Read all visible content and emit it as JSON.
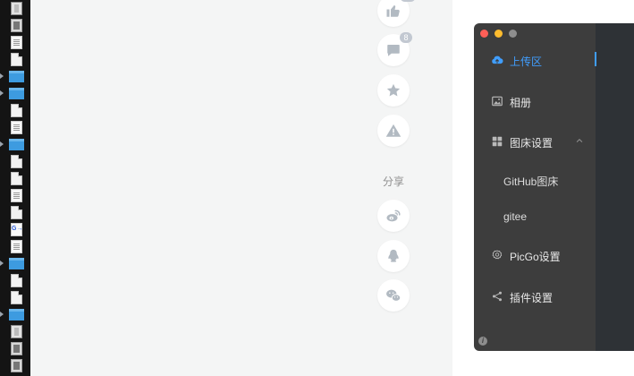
{
  "file_browser": {
    "rows": [
      {
        "icon": "device-icon",
        "arrow": false
      },
      {
        "icon": "image-file-icon",
        "arrow": false
      },
      {
        "icon": "document-icon",
        "arrow": false
      },
      {
        "icon": "file-icon",
        "arrow": false
      },
      {
        "icon": "folder-icon",
        "arrow": true
      },
      {
        "icon": "folder-icon",
        "arrow": true
      },
      {
        "icon": "file-icon",
        "arrow": false
      },
      {
        "icon": "document-icon",
        "arrow": false
      },
      {
        "icon": "folder-icon",
        "arrow": true
      },
      {
        "icon": "file-icon",
        "arrow": false
      },
      {
        "icon": "file-icon",
        "arrow": false
      },
      {
        "icon": "document-icon",
        "arrow": false
      },
      {
        "icon": "file-icon",
        "arrow": false
      },
      {
        "icon": "link-file-icon",
        "arrow": false
      },
      {
        "icon": "document-icon",
        "arrow": false
      },
      {
        "icon": "folder-icon",
        "arrow": true
      },
      {
        "icon": "file-icon",
        "arrow": false
      },
      {
        "icon": "file-icon",
        "arrow": false
      },
      {
        "icon": "folder-icon",
        "arrow": true
      },
      {
        "icon": "device-icon",
        "arrow": false
      },
      {
        "icon": "image-file-icon",
        "arrow": false
      },
      {
        "icon": "image-file-icon",
        "arrow": false
      }
    ]
  },
  "article_actions": {
    "like_count": "",
    "comment_count": "8",
    "share_label": "分享"
  },
  "picgo": {
    "menu": {
      "upload": "上传区",
      "album": "相册",
      "bed_settings": "图床设置",
      "github_bed": "GitHub图床",
      "gitee": "gitee",
      "picgo_settings": "PicGo设置",
      "plugin_settings": "插件设置"
    },
    "info_icon_glyph": "i"
  },
  "colors": {
    "accent": "#409eff",
    "sidebar_bg": "#3d3d3d",
    "content_bg": "#2e3236",
    "page_bg": "#f4f5f5",
    "icon_gray": "#b2bac2"
  }
}
